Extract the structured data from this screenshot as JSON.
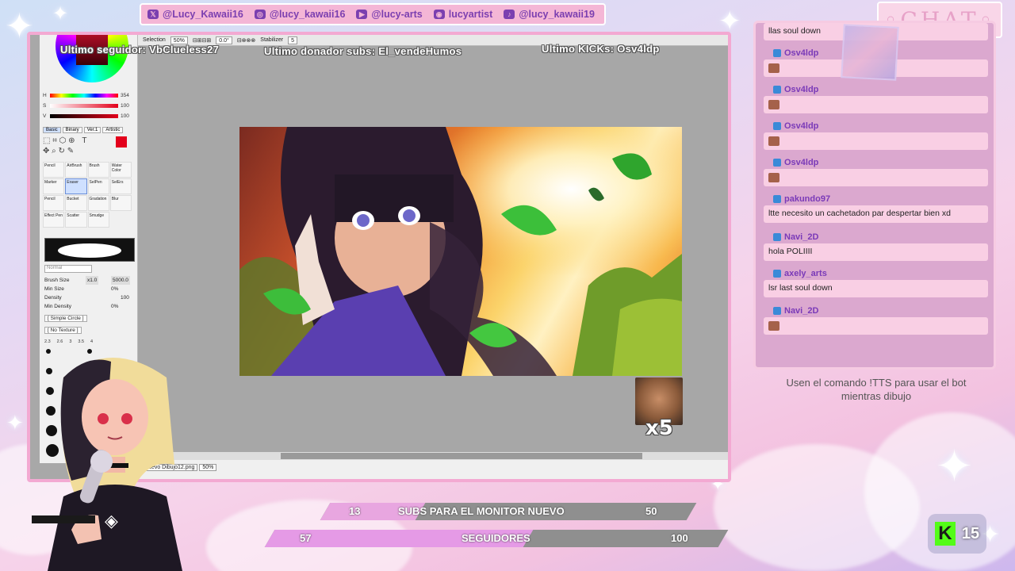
{
  "social": [
    {
      "icon": "x-icon",
      "glyph": "𝕏",
      "handle": "@Lucy_Kawaii16"
    },
    {
      "icon": "instagram-icon",
      "glyph": "◎",
      "handle": "@lucy_kawaii16"
    },
    {
      "icon": "youtube-icon",
      "glyph": "▶",
      "handle": "@lucy-arts"
    },
    {
      "icon": "discord-icon",
      "glyph": "◉",
      "handle": "lucyartist"
    },
    {
      "icon": "tiktok-icon",
      "glyph": "♪",
      "handle": "@lucy_kawaii19"
    }
  ],
  "chat_title": "◦CHAT◦",
  "overlay": {
    "last_follower": "Ultimo seguidor: VbClueless27",
    "last_donor": "Ultimo donador subs: El_vendeHumos",
    "last_kicks": "Ultimo KICKs: Osv4ldp"
  },
  "paint_app": {
    "toolbar": {
      "selection": "Selection",
      "zoom": "50%",
      "angle": "0.0°",
      "stabilizer_label": "Stabilizer",
      "stabilizer_value": "5"
    },
    "hsv": [
      {
        "label": "H",
        "value": "354"
      },
      {
        "label": "S",
        "value": "100"
      },
      {
        "label": "V",
        "value": "100"
      }
    ],
    "tabs": [
      "Basic",
      "Binary",
      "Ver.1",
      "Artistic"
    ],
    "tools": [
      "Pencil",
      "AirBrush",
      "Brush",
      "Water Color",
      "Marker",
      "Eraser",
      "SelPen",
      "SelErs",
      "Pencil",
      "Bucket",
      "Gradation",
      "Blur",
      "Effect Pen",
      "Scatter",
      "Smudge"
    ],
    "blend_mode": "Normal",
    "brush_size_label": "Brush Size",
    "brush_size_mult": "x1.0",
    "brush_size_value": "5000.0",
    "min_size_label": "Min Size",
    "min_size_value": "0%",
    "density_label": "Density",
    "density_value": "100",
    "min_density_label": "Min Density",
    "min_density_value": "0%",
    "shape_option": "[ Simple Circle ]",
    "texture_option": "[ No Texture ]",
    "size_presets": [
      "2.3",
      "2.6",
      "3",
      "3.5",
      "4"
    ],
    "status_file": "Nuevo Dibujo12.png",
    "status_zoom": "50%"
  },
  "emote": {
    "name": "emote-laughing-man",
    "count": "x5"
  },
  "chat": [
    {
      "user": "",
      "text": "llas soul down",
      "has_emote": false
    },
    {
      "user": "Osv4ldp",
      "text": "",
      "has_emote": true
    },
    {
      "user": "Osv4ldp",
      "text": "",
      "has_emote": true
    },
    {
      "user": "Osv4ldp",
      "text": "",
      "has_emote": true
    },
    {
      "user": "Osv4ldp",
      "text": "",
      "has_emote": true
    },
    {
      "user": "pakundo97",
      "text": "ltte necesito un cachetadon par despertar bien xd",
      "has_emote": false
    },
    {
      "user": "Navi_2D",
      "text": "hola POLIIII",
      "has_emote": false
    },
    {
      "user": "axely_arts",
      "text": "lsr last soul down",
      "has_emote": false
    },
    {
      "user": "Navi_2D",
      "text": "",
      "has_emote": true
    }
  ],
  "tts_note": "Usen el comando !TTS para usar el bot mientras dibujo",
  "goals": [
    {
      "label": "SUBS PARA EL MONITOR NUEVO",
      "current": "13",
      "target": "50",
      "progress": 0.26,
      "fill_color": "#e8a6e0",
      "bg_color": "#8f8f8f"
    },
    {
      "label": "SEGUIDORES",
      "current": "57",
      "target": "100",
      "progress": 0.57,
      "fill_color": "#e59ae6",
      "bg_color": "#8f8f8f"
    }
  ],
  "kick": {
    "count": "15",
    "color": "#53fc18"
  },
  "colors": {
    "accent_pink": "#f3a9d2",
    "chat_bg": "#dba8cf",
    "username": "#7a3ab8"
  }
}
